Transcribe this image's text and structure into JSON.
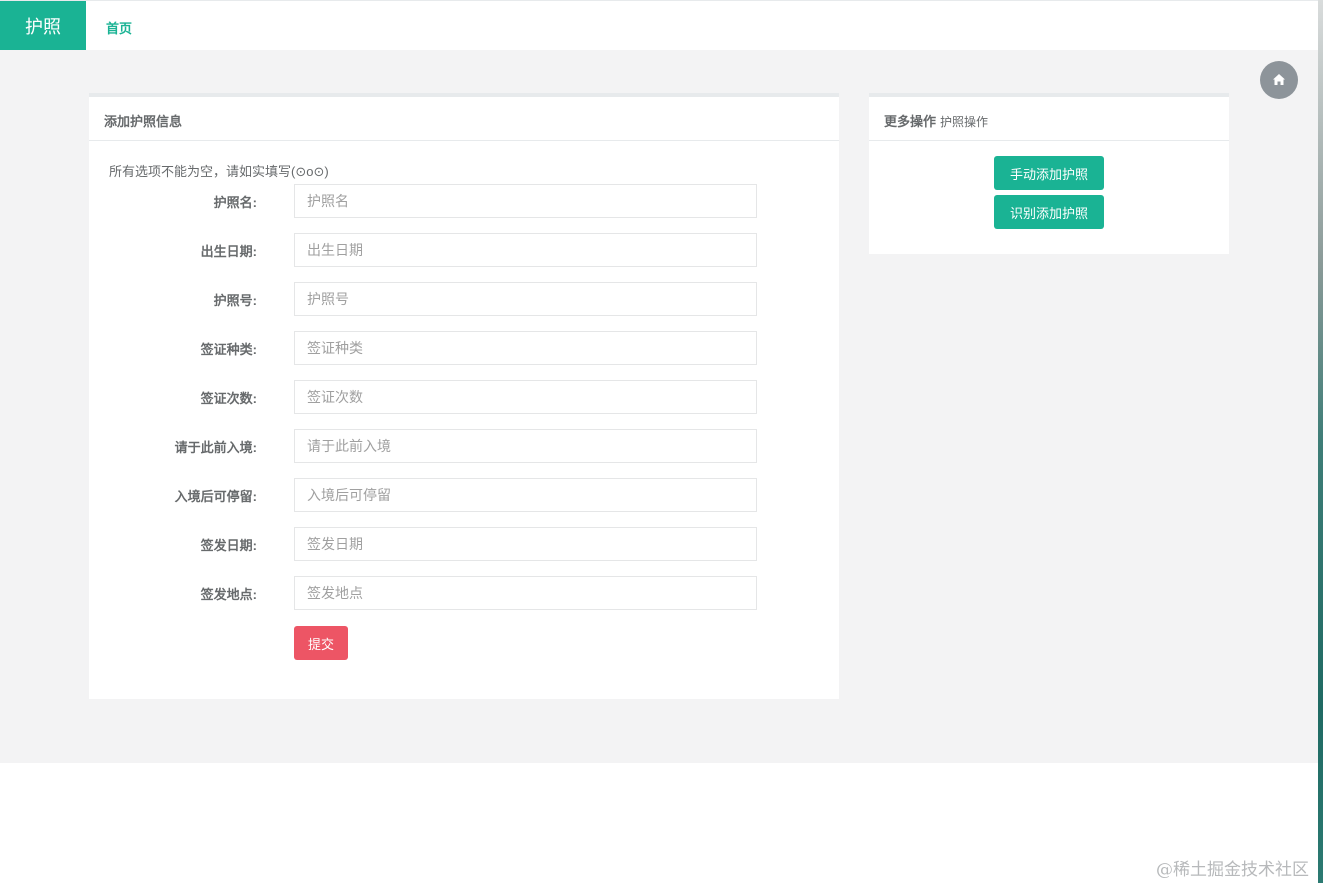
{
  "header": {
    "brand": "护照",
    "nav_home": "首页"
  },
  "form_panel": {
    "title": "添加护照信息",
    "notice": "所有选项不能为空，请如实填写(⊙o⊙)",
    "fields": [
      {
        "label": "护照名:",
        "placeholder": "护照名",
        "value": ""
      },
      {
        "label": "出生日期:",
        "placeholder": "出生日期",
        "value": ""
      },
      {
        "label": "护照号:",
        "placeholder": "护照号",
        "value": ""
      },
      {
        "label": "签证种类:",
        "placeholder": "签证种类",
        "value": ""
      },
      {
        "label": "签证次数:",
        "placeholder": "签证次数",
        "value": ""
      },
      {
        "label": "请于此前入境:",
        "placeholder": "请于此前入境",
        "value": ""
      },
      {
        "label": "入境后可停留:",
        "placeholder": "入境后可停留",
        "value": ""
      },
      {
        "label": "签发日期:",
        "placeholder": "签发日期",
        "value": ""
      },
      {
        "label": "签发地点:",
        "placeholder": "签发地点",
        "value": ""
      }
    ],
    "submit_label": "提交"
  },
  "actions_panel": {
    "title": "更多操作",
    "subtitle": "护照操作",
    "manual_add_label": "手动添加护照",
    "recognize_add_label": "识别添加护照"
  },
  "watermark": "@稀土掘金技术社区",
  "icons": {
    "home": "home-icon"
  },
  "colors": {
    "primary": "#1ab394",
    "danger": "#ed5565",
    "page_bg": "#f3f3f4"
  }
}
